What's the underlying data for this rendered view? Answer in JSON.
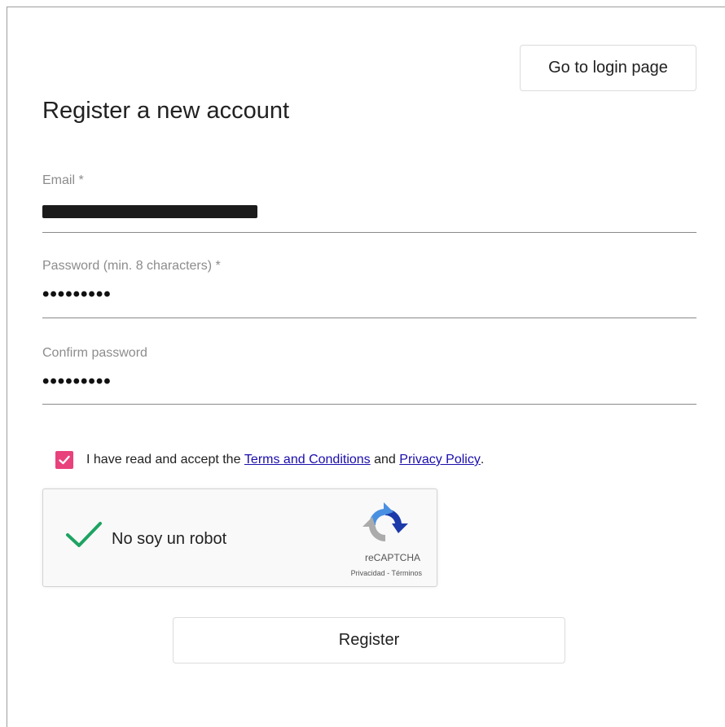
{
  "header": {
    "login_button_label": "Go to login page"
  },
  "form": {
    "title": "Register a new account",
    "email": {
      "label": "Email *",
      "value_redacted": true
    },
    "password": {
      "label": "Password (min. 8 characters) *",
      "value": "•••••••••"
    },
    "confirm_password": {
      "label": "Confirm password",
      "value": "•••••••••"
    },
    "terms": {
      "checked": true,
      "text_before": "I have read and accept the",
      "terms_link": "Terms and Conditions",
      "text_middle": "and",
      "privacy_link": "Privacy Policy",
      "text_after": ".",
      "checkbox_color": "#e8417c"
    },
    "recaptcha": {
      "label": "No soy un robot",
      "brand": "reCAPTCHA",
      "privacy_link": "Privacidad",
      "separator": "-",
      "terms_link": "Términos",
      "checked": true,
      "check_color": "#1ea362"
    },
    "register_button_label": "Register"
  },
  "icons": [
    "checkmark-icon",
    "green-check-icon",
    "recaptcha-logo-icon"
  ]
}
